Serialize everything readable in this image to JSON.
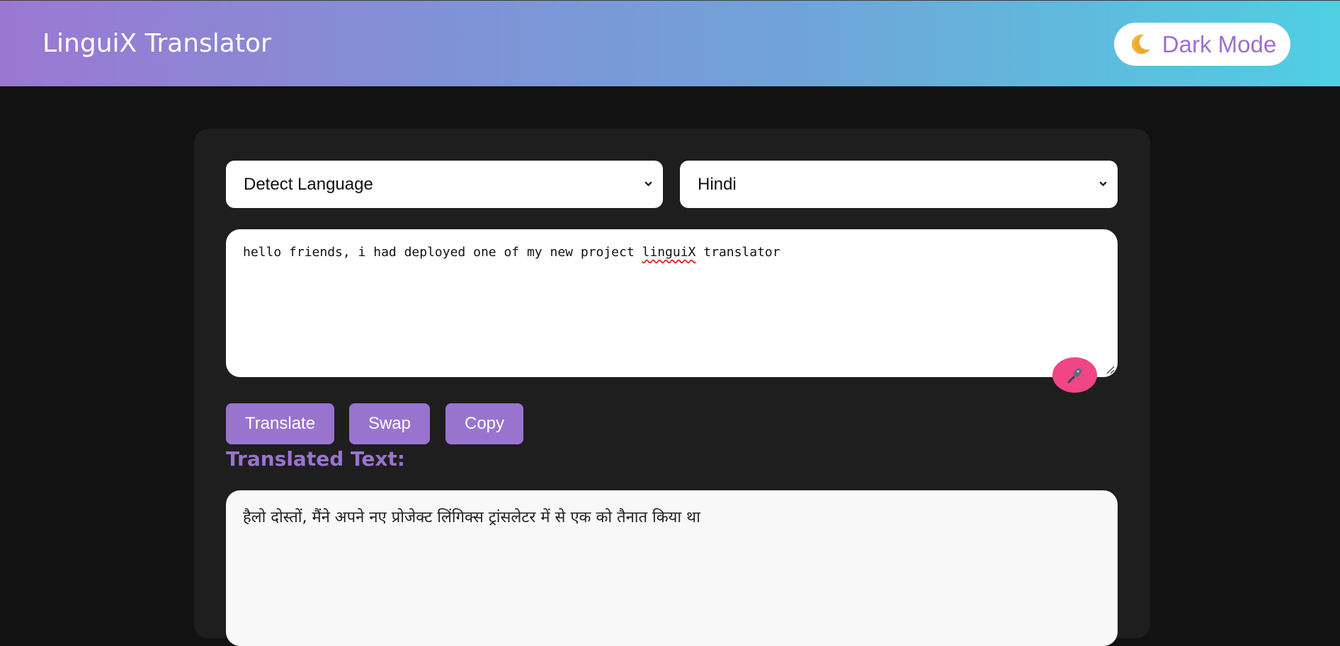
{
  "header": {
    "title": "LinguiX Translator",
    "mode_toggle_label": "Dark Mode",
    "mode_toggle_icon": "moon-icon"
  },
  "selectors": {
    "source_language": "Detect Language",
    "target_language": "Hindi"
  },
  "input": {
    "text_before": "hello friends, i had deployed one of my new project ",
    "text_misspelled": "linguiX",
    "text_after": " translator"
  },
  "actions": {
    "translate_label": "Translate",
    "swap_label": "Swap",
    "copy_label": "Copy",
    "mic_icon": "microphone-icon"
  },
  "output": {
    "label": "Translated Text:",
    "text": "हैलो दोस्तों, मैंने अपने नए प्रोजेक्ट लिंगिक्स ट्रांसलेटर में से एक को तैनात किया था"
  },
  "colors": {
    "accent": "#9874cf",
    "mic": "#f04686",
    "background": "#121212",
    "card": "#1e1e1e"
  }
}
